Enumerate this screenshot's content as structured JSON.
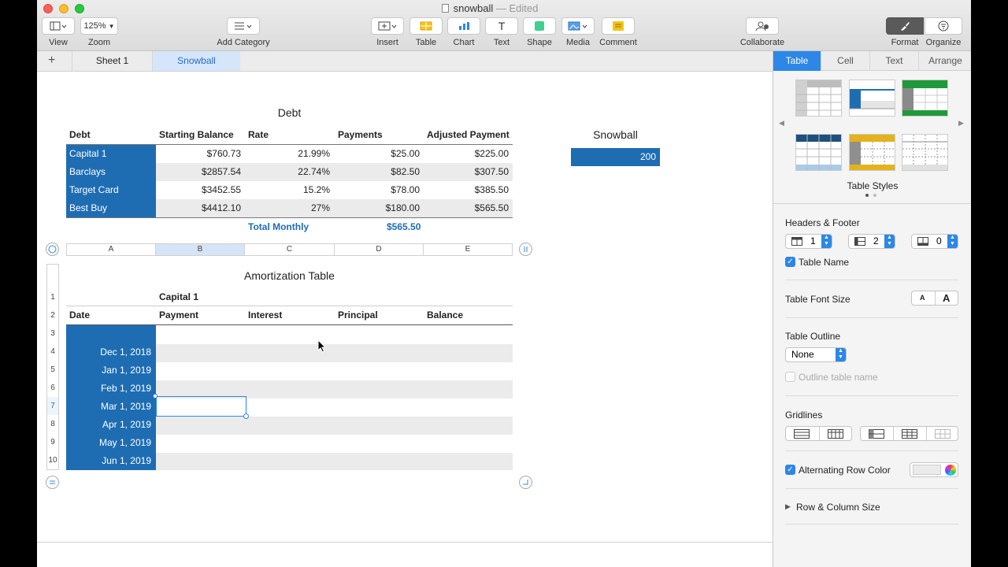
{
  "window": {
    "title": "snowball",
    "title_status": "— Edited"
  },
  "toolbar": {
    "view": "View",
    "zoom_value": "125%",
    "zoom": "Zoom",
    "add_category": "Add Category",
    "insert": "Insert",
    "table": "Table",
    "chart": "Chart",
    "text": "Text",
    "shape": "Shape",
    "media": "Media",
    "comment": "Comment",
    "collaborate": "Collaborate",
    "format": "Format",
    "organize": "Organize"
  },
  "sheets": {
    "tabs": [
      "Sheet 1",
      "Snowball"
    ],
    "active": "Snowball"
  },
  "debt_table": {
    "title": "Debt",
    "headers": [
      "Debt",
      "Starting Balance",
      "Rate",
      "Payments",
      "Adjusted Payment"
    ],
    "rows": [
      [
        "Capital 1",
        "$760.73",
        "21.99%",
        "$25.00",
        "$225.00"
      ],
      [
        "Barclays",
        "$2857.54",
        "22.74%",
        "$82.50",
        "$307.50"
      ],
      [
        "Target Card",
        "$3452.55",
        "15.2%",
        "$78.00",
        "$385.50"
      ],
      [
        "Best Buy",
        "$4412.10",
        "27%",
        "$180.00",
        "$565.50"
      ]
    ],
    "footer_label": "Total Monthly",
    "footer_value": "$565.50"
  },
  "snowball_table": {
    "title": "Snowball",
    "value": "200"
  },
  "amort_table": {
    "title": "Amortization Table",
    "column_letters": [
      "A",
      "B",
      "C",
      "D",
      "E"
    ],
    "selected_column": "B",
    "row1_label": "Capital 1",
    "headers": [
      "Date",
      "Payment",
      "Interest",
      "Principal",
      "Balance"
    ],
    "row_numbers": [
      "1",
      "2",
      "3",
      "4",
      "5",
      "6",
      "7",
      "8",
      "9",
      "10"
    ],
    "selected_row": "7",
    "dates": [
      "",
      "Dec 1, 2018",
      "Jan 1, 2019",
      "Feb 1, 2019",
      "Mar 1, 2019",
      "Apr 1, 2019",
      "May 1, 2019",
      "Jun 1, 2019"
    ]
  },
  "inspector": {
    "tabs": [
      "Table",
      "Cell",
      "Text",
      "Arrange"
    ],
    "active_tab": "Table",
    "styles_label": "Table Styles",
    "headers_footer": "Headers & Footer",
    "header_rows": "1",
    "header_cols": "2",
    "footer_rows": "0",
    "table_name": "Table Name",
    "font_size": "Table Font Size",
    "font_small": "A",
    "font_large": "A",
    "outline": "Table Outline",
    "outline_value": "None",
    "outline_name": "Outline table name",
    "gridlines": "Gridlines",
    "alt_row": "Alternating Row Color",
    "row_col_size": "Row & Column Size",
    "accent": "#2c87e6"
  }
}
